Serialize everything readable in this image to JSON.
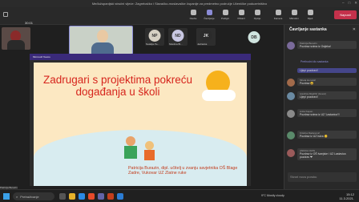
{
  "window": {
    "title": "Međužupanijski stručni vijeće: Zagrebačko i Slavačko-moslavačke županije za predmetno područje Učeničke poduzetništvo"
  },
  "toolbar": {
    "timer": "30:01",
    "leave": "Napusti",
    "buttons": [
      "Osobe",
      "Čavrljanje",
      "Podigni",
      "Prikazi",
      "Opcije",
      "Kamera",
      "Mikrofon",
      "Dijeli"
    ]
  },
  "participants": [
    {
      "initials": "NP",
      "name": "Natalija Pe...",
      "color": "#d6d0c4"
    },
    {
      "initials": "ND",
      "name": "Nikolina Bl...",
      "color": "#c9c8e3"
    },
    {
      "initials": "JK",
      "name": "Jadranka",
      "color": "#2b2b2b"
    },
    {
      "initials": "DB",
      "name": "",
      "color": "#cfe4df"
    }
  ],
  "slide": {
    "app_bar": "Microsoft Teams",
    "title": "Zadrugari s projektima pokreću događanja u školi",
    "authors": "Patricija Burazin, dipl. učitelj u zvanju savjetnika OŠ Blage Zadre, Vukovar UZ Zlatne ruke"
  },
  "self_view": {
    "label": "Patricija Burazin"
  },
  "chat": {
    "title": "Čavrljanje sastanka",
    "sub": "Prethodni dio sastanka",
    "messages": [
      {
        "author": "Patricija Burazin",
        "text": "Pozdrav svima iz Osijeka!"
      },
      {
        "author": "",
        "text": "Lijepi pozdravi!"
      },
      {
        "author": "Mirela Horvatić",
        "text": "Pozdrav 😀"
      },
      {
        "author": "Ivančica Mujdžić (Guest)",
        "text": "Lijepi pozdravi!"
      },
      {
        "author": "Anita Kapan",
        "text": "Pozdrav svima iz UZ 'Lastavica'!!"
      },
      {
        "author": "Kristina Radanović",
        "text": "Pozdrav iz UZ Iskra 😊"
      },
      {
        "author": "ANKICA OZIN",
        "text": "Pozdrav iz OŠ Ivanjske i UZ Lastavica pozdrav ❤"
      }
    ],
    "input_placeholder": "Stvori novu poruku"
  },
  "taskbar": {
    "search": "Pretraživanje",
    "weather": "9°C Mostly cloudy",
    "time": "15:12",
    "date": "11.3.2021."
  },
  "colors": {
    "accent": "#6264a7",
    "leave": "#c4314b",
    "slide_title": "#d6251d"
  }
}
